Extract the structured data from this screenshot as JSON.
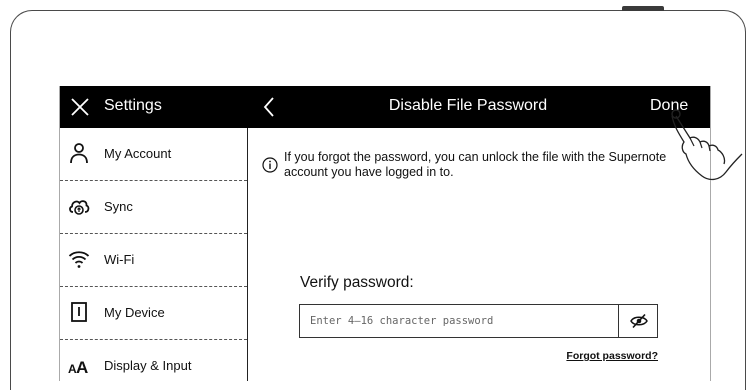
{
  "header": {
    "settings_title": "Settings",
    "page_title": "Disable File Password",
    "done_label": "Done"
  },
  "sidebar": {
    "items": [
      {
        "label": "My Account",
        "icon": "user-icon"
      },
      {
        "label": "Sync",
        "icon": "cloud-sync-icon"
      },
      {
        "label": "Wi-Fi",
        "icon": "wifi-icon"
      },
      {
        "label": "My Device",
        "icon": "device-icon"
      },
      {
        "label": "Display & Input",
        "icon": "font-size-icon"
      }
    ]
  },
  "main": {
    "info_text": "If you forgot the password, you can unlock the file with the Supernote account you have logged in to.",
    "verify_label": "Verify password:",
    "password_placeholder": "Enter 4–16 character password",
    "password_value": "",
    "forgot_link": "Forgot password?"
  }
}
